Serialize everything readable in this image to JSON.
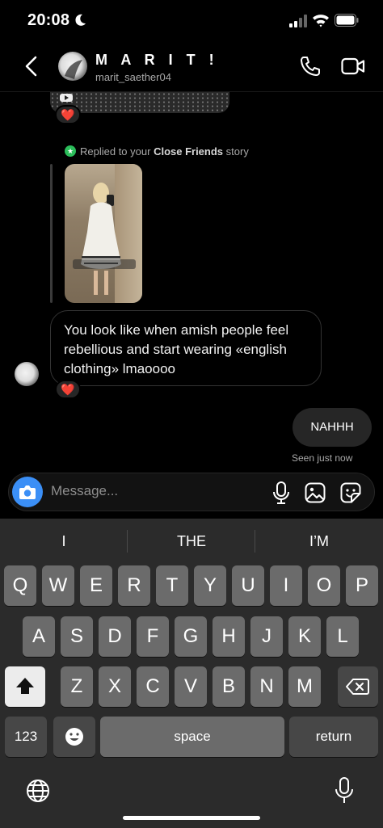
{
  "status": {
    "time": "20:08"
  },
  "header": {
    "name": "M A R I T !",
    "username": "marit_saether04"
  },
  "messages": {
    "reaction_emoji": "❤️",
    "reply_prefix": "Replied to your ",
    "reply_bold": "Close Friends",
    "reply_suffix": " story",
    "received_text": "You look like when amish people feel rebellious and start wearing «english clothing» lmaoooo",
    "sent_text": "NAHHH",
    "seen_text": "Seen just now"
  },
  "composer": {
    "placeholder": "Message..."
  },
  "keyboard": {
    "suggestions": [
      "I",
      "THE",
      "I’M"
    ],
    "row1": [
      "Q",
      "W",
      "E",
      "R",
      "T",
      "Y",
      "U",
      "I",
      "O",
      "P"
    ],
    "row2": [
      "A",
      "S",
      "D",
      "F",
      "G",
      "H",
      "J",
      "K",
      "L"
    ],
    "row3": [
      "Z",
      "X",
      "C",
      "V",
      "B",
      "N",
      "M"
    ],
    "numbers_label": "123",
    "space_label": "space",
    "return_label": "return"
  },
  "colors": {
    "accent": "#3b8ff6",
    "close_friends": "#2bbd5a",
    "heart": "#ff3040"
  },
  "icons": [
    "moon-icon",
    "signal-icon",
    "wifi-icon",
    "battery-icon",
    "back-icon",
    "phone-icon",
    "video-icon",
    "camera-icon",
    "mic-icon",
    "gallery-icon",
    "sticker-icon",
    "shift-icon",
    "backspace-icon",
    "emoji-icon",
    "globe-icon"
  ]
}
